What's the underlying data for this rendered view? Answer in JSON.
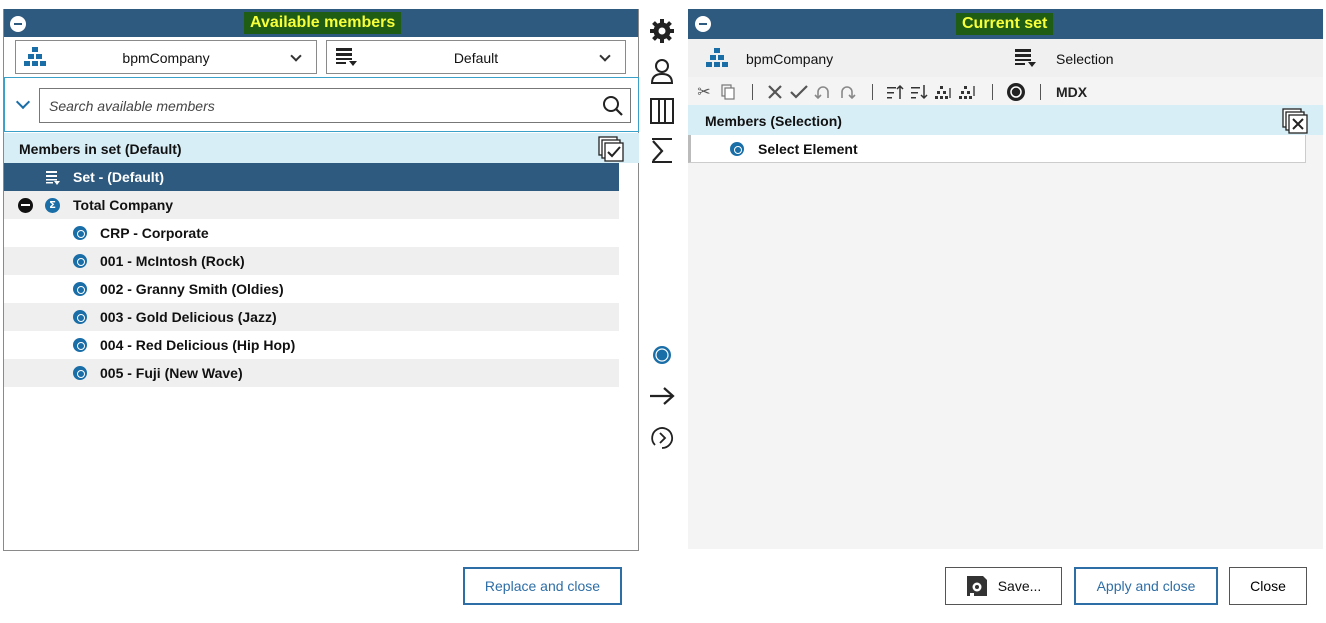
{
  "left": {
    "title": "Available members",
    "dimension_dropdown": "bpmCompany",
    "set_dropdown": "Default",
    "search_placeholder": "Search available members",
    "section_title": "Members in set (Default)",
    "set_row": "Set - (Default)",
    "tree": [
      {
        "label": "Total Company",
        "level": 0
      },
      {
        "label": "CRP - Corporate",
        "level": 1
      },
      {
        "label": "001 - McIntosh (Rock)",
        "level": 1
      },
      {
        "label": "002 - Granny Smith (Oldies)",
        "level": 1
      },
      {
        "label": "003 - Gold Delicious (Jazz)",
        "level": 1
      },
      {
        "label": "004 - Red Delicious (Hip Hop)",
        "level": 1
      },
      {
        "label": "005 - Fuji (New Wave)",
        "level": 1
      }
    ]
  },
  "middle": {
    "icons": [
      "gear-icon",
      "user-icon",
      "columns-icon",
      "sigma-icon",
      "select-radio-icon",
      "arrow-right-icon",
      "refresh-icon"
    ]
  },
  "right": {
    "title": "Current set",
    "dimension": "bpmCompany",
    "set_name": "Selection",
    "mdx_label": "MDX",
    "section_title": "Members (Selection)",
    "select_element": "Select Element"
  },
  "buttons": {
    "replace_close": "Replace and close",
    "save": "Save...",
    "apply_close": "Apply and close",
    "close": "Close"
  },
  "colors": {
    "header_bg": "#2f5a7f",
    "highlight_bg": "#1f5c14",
    "highlight_text": "#f7ff3a",
    "section_bg": "#d7eef7",
    "accent": "#1a6ea8",
    "button_accent": "#2e6ea6"
  }
}
